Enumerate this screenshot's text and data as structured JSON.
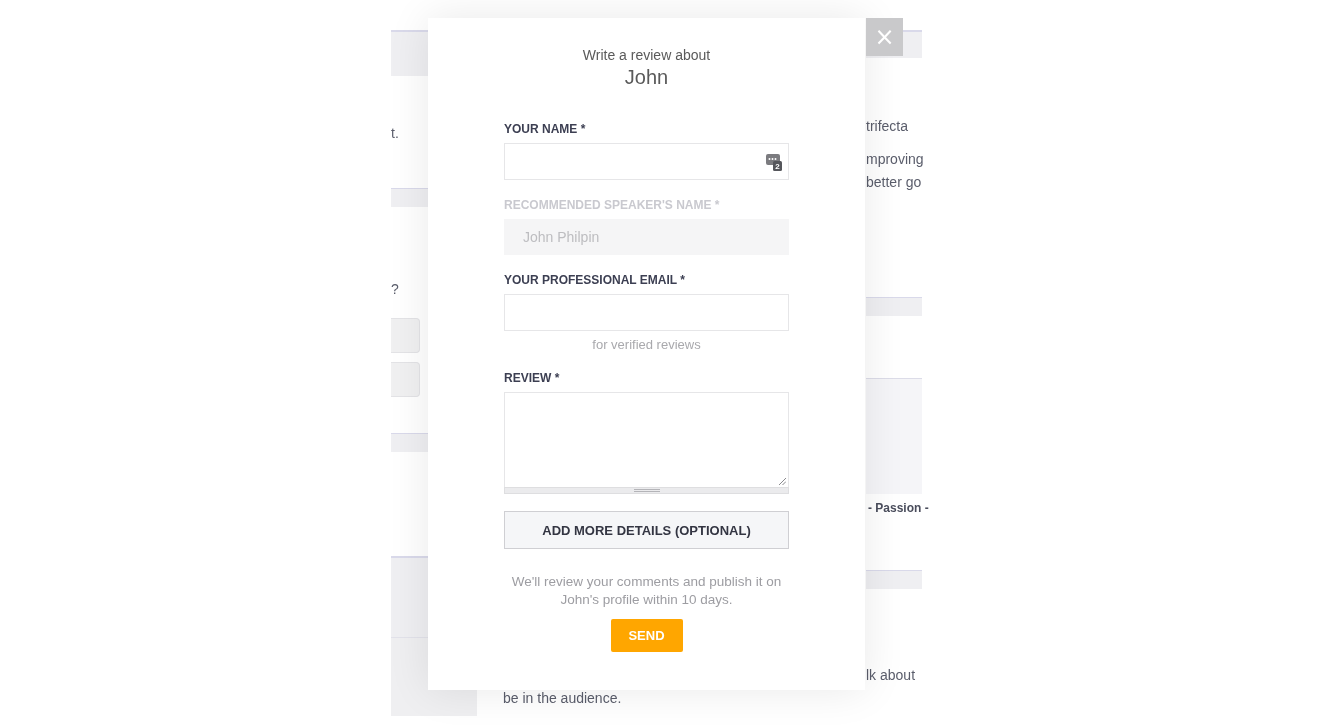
{
  "background_page": {
    "left_texts": [
      "t.",
      "?"
    ],
    "right_texts": [
      "trifecta",
      "mproving",
      "better go"
    ],
    "right_bold_text": "- Passion -",
    "right_bottom_text": "lk about",
    "bottom_text": "be in the audience."
  },
  "close_button": {
    "label": "×"
  },
  "review_dialog": {
    "heading": "Write a review about",
    "subject": "John",
    "fields": [
      {
        "kind": "input",
        "label": "YOUR NAME *",
        "disabled": false,
        "autofill_badge": "2"
      },
      {
        "kind": "input",
        "label": "RECOMMENDED SPEAKER'S NAME *",
        "disabled": true,
        "value": "John Philpin"
      },
      {
        "kind": "input",
        "label": "YOUR PROFESSIONAL EMAIL *",
        "disabled": false,
        "hint": "for verified reviews"
      },
      {
        "kind": "textarea",
        "label": "REVIEW *",
        "disabled": false
      }
    ],
    "details_button": "ADD MORE DETAILS (OPTIONAL)",
    "notice": "We'll review your comments and publish it on John's profile within 10 days.",
    "send_button": "SEND"
  }
}
